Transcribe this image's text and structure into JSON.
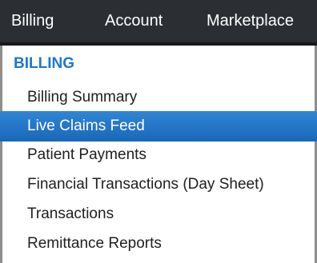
{
  "top_nav": {
    "items": [
      "Billing",
      "Account",
      "Marketplace"
    ]
  },
  "billing_menu": {
    "heading": "BILLING",
    "items": [
      "Billing Summary",
      "Live Claims Feed",
      "Patient Payments",
      "Financial Transactions (Day Sheet)",
      "Transactions",
      "Remittance Reports"
    ],
    "selected": "Live Claims Feed"
  },
  "colors": {
    "nav_background": "#2b2e33",
    "heading": "#1b79cf",
    "selected_background": "#2477c6"
  }
}
